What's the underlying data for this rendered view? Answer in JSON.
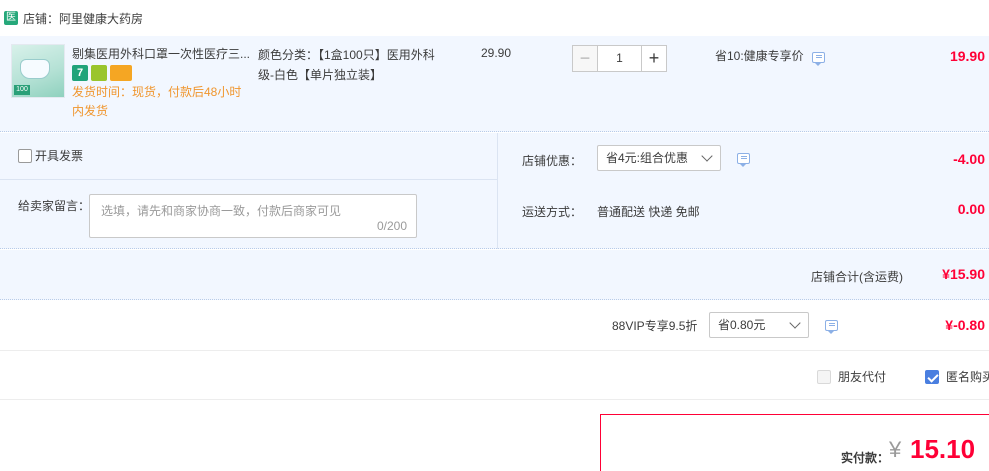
{
  "shop": {
    "badge": "医",
    "title": "店铺：阿里健康大药房"
  },
  "item": {
    "title": "剔集医用外科口罩一次性医疗三...",
    "thumb_tag": "100",
    "badges": [
      "7",
      "",
      ""
    ],
    "ship_time": "发货时间：现货，付款后48小时内发货",
    "sku": "颜色分类：【1盒100只】医用外科级-白色【单片独立装】",
    "unit_price": "29.90",
    "quantity": "1",
    "minus_label": "−",
    "plus_label": "+",
    "discount": "省10:健康专享价",
    "total": "19.90"
  },
  "invoice": {
    "label": "开具发票"
  },
  "memo": {
    "label": "给卖家留言：",
    "placeholder": "选填，请先和商家协商一致，付款后商家可见",
    "count": "0/200"
  },
  "shop_promo": {
    "label": "店铺优惠：",
    "selected": "省4元:组合优惠",
    "amount": "-4.00"
  },
  "shipping": {
    "label": "运送方式：",
    "value": "普通配送 快递 免邮",
    "amount": "0.00"
  },
  "subtotal": {
    "label": "店铺合计(含运费)",
    "value": "¥15.90"
  },
  "vip": {
    "label": "88VIP专享9.5折",
    "selected": "省0.80元",
    "amount": "¥-0.80"
  },
  "options": {
    "friend_pay": "朋友代付",
    "anonymous": "匿名购买"
  },
  "payment": {
    "label": "实付款：",
    "currency": "¥",
    "amount": "15.10"
  },
  "colors": {
    "accent_red": "#ff0036",
    "panel_bg": "#f2f7ff",
    "ship_time_orange": "#f0962e",
    "check_blue": "#4a7fe0"
  }
}
